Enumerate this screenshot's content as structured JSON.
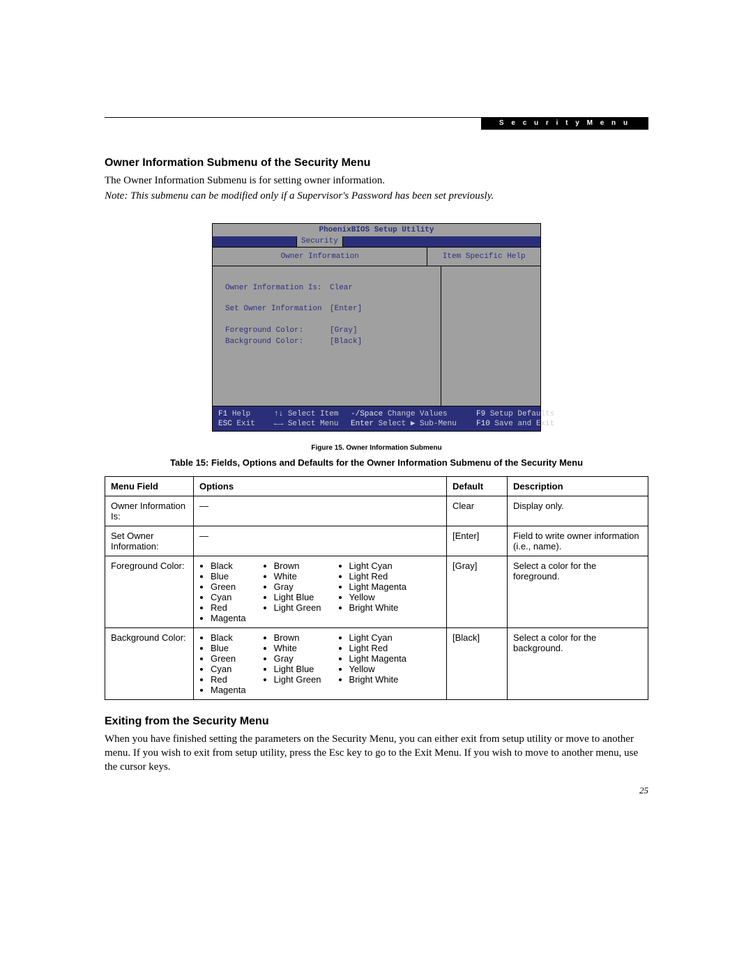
{
  "header": {
    "tab_label": "S e c u r i t y   M e n u"
  },
  "section1": {
    "heading": "Owner Information Submenu of the Security Menu",
    "para1": "The Owner Information Submenu is for setting owner information.",
    "para2": "Note: This submenu can be modified only if a Supervisor's Password has been set previously."
  },
  "bios": {
    "title": "PhoenixBIOS Setup Utility",
    "tab": "Security",
    "left_header": "Owner Information",
    "right_header": "Item Specific Help",
    "rows": [
      {
        "label": "Owner Information Is:",
        "value": "Clear"
      },
      {
        "label": "Set Owner Information",
        "value": "[Enter]"
      },
      {
        "label": "Foreground Color:",
        "value": "[Gray]"
      },
      {
        "label": "Background Color:",
        "value": "[Black]"
      }
    ],
    "keys": {
      "row1": [
        {
          "k": "F1",
          "d": "Help"
        },
        {
          "k": "↑↓",
          "d": "Select Item"
        },
        {
          "k": "-/Space",
          "d": "Change Values"
        },
        {
          "k": "F9",
          "d": "Setup Defaults"
        }
      ],
      "row2": [
        {
          "k": "ESC",
          "d": "Exit"
        },
        {
          "k": "←→",
          "d": "Select Menu"
        },
        {
          "k": "Enter",
          "d": "Select ▶ Sub-Menu"
        },
        {
          "k": "F10",
          "d": "Save and Exit"
        }
      ]
    }
  },
  "figure_caption": "Figure 15.  Owner Information Submenu",
  "table_title": "Table 15: Fields, Options and Defaults for the Owner Information Submenu of the Security Menu",
  "table": {
    "headers": [
      "Menu Field",
      "Options",
      "Default",
      "Description"
    ],
    "rows": [
      {
        "field": "Owner Information Is:",
        "options_text": "—",
        "default": "Clear",
        "description": "Display only."
      },
      {
        "field": "Set Owner Information:",
        "options_text": "—",
        "default": "[Enter]",
        "description": "Field to write owner information (i.e., name)."
      },
      {
        "field": "Foreground Color:",
        "options_cols": [
          [
            "Black",
            "Blue",
            "Green",
            "Cyan",
            "Red",
            "Magenta"
          ],
          [
            "Brown",
            "White",
            "Gray",
            "Light Blue",
            "Light Green"
          ],
          [
            "Light Cyan",
            "Light Red",
            "Light Magenta",
            "Yellow",
            "Bright White"
          ]
        ],
        "default": "[Gray]",
        "description": "Select a color for the foreground."
      },
      {
        "field": "Background Color:",
        "options_cols": [
          [
            "Black",
            "Blue",
            "Green",
            "Cyan",
            "Red",
            "Magenta"
          ],
          [
            "Brown",
            "White",
            "Gray",
            "Light Blue",
            "Light Green"
          ],
          [
            "Light Cyan",
            "Light Red",
            "Light Magenta",
            "Yellow",
            "Bright White"
          ]
        ],
        "default": "[Black]",
        "description": "Select a color for the background."
      }
    ]
  },
  "section2": {
    "heading": "Exiting from the Security Menu",
    "para": "When you have finished setting the parameters on the Security Menu, you can either exit from setup utility or move to another menu. If you wish to exit from setup utility, press the Esc key to go to the Exit Menu. If you wish to move to another menu, use the cursor keys."
  },
  "page_number": "25"
}
